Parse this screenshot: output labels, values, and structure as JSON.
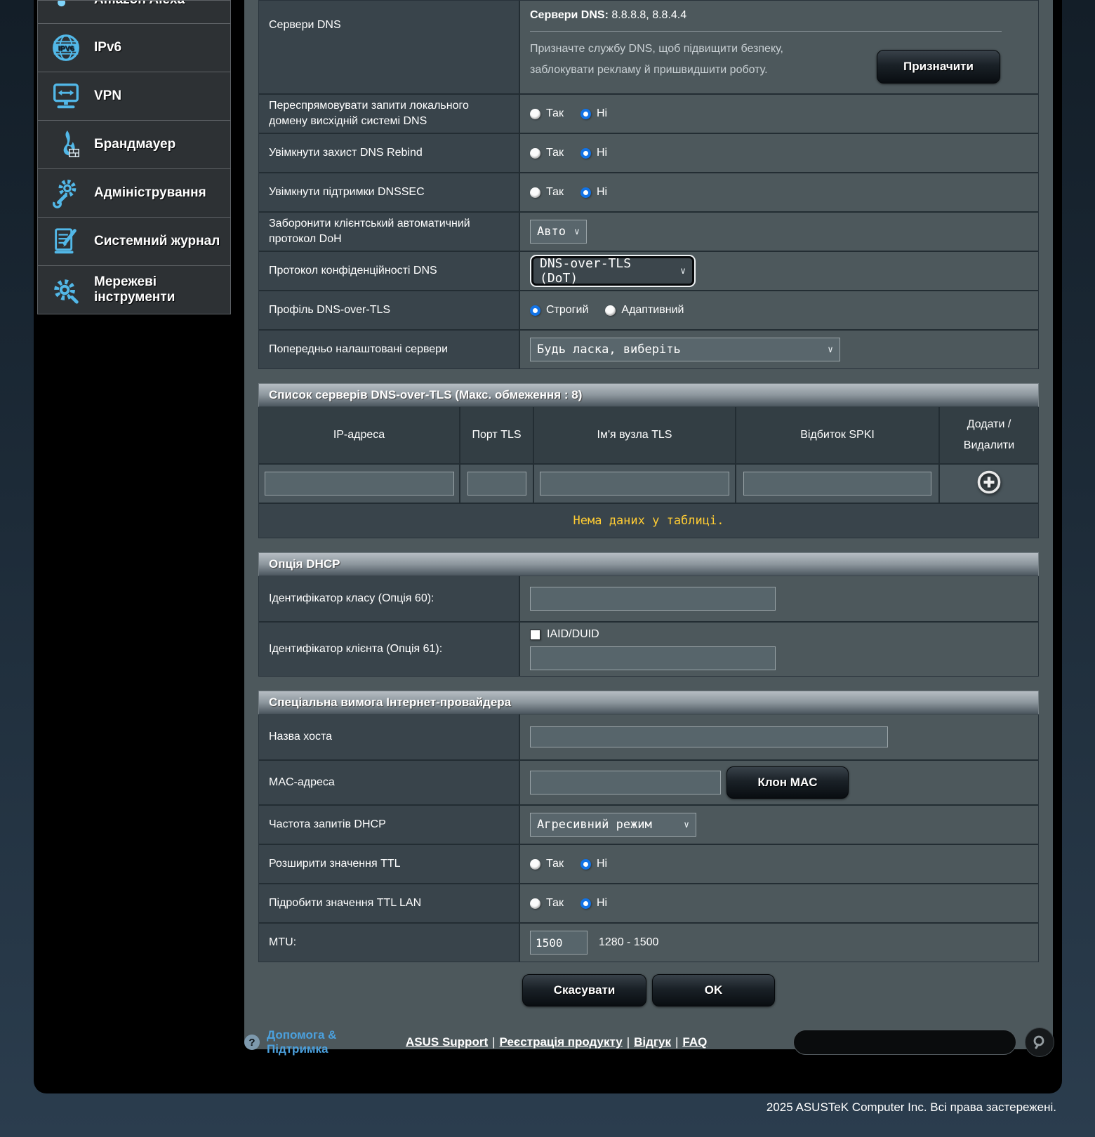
{
  "sidebar": {
    "items": [
      {
        "label": "Amazon Alexa",
        "icon": "alexa-icon"
      },
      {
        "label": "IPv6",
        "icon": "ipv6-icon"
      },
      {
        "label": "VPN",
        "icon": "vpn-icon"
      },
      {
        "label": "Брандмауер",
        "icon": "firewall-icon"
      },
      {
        "label": "Адміністрування",
        "icon": "administration-icon"
      },
      {
        "label": "Системний журнал",
        "icon": "system-log-icon"
      },
      {
        "label": "Мережеві інструменти",
        "icon": "network-tools-icon"
      }
    ]
  },
  "form": {
    "yes": "Так",
    "no": "Ні",
    "rows": {
      "dns_servers": {
        "label": "Сервери DNS",
        "value_label": "Сервери DNS:",
        "value": "8.8.8.8, 8.8.4.4",
        "desc1": "Призначте службу DNS, щоб підвищити безпеку,",
        "desc2": "заблокувати рекламу й пришвидшити роботу.",
        "assign_button": "Призначити"
      },
      "forward_local": {
        "label": "Переспрямовувати запити локального домену висхідній системі DNS",
        "selected": "Ні"
      },
      "dns_rebind": {
        "label": "Увімкнути захист DNS Rebind",
        "selected": "Ні"
      },
      "dnssec": {
        "label": "Увімкнути підтримки DNSSEC",
        "selected": "Ні"
      },
      "doh": {
        "label": "Заборонити клієнтський автоматичний протокол DoH",
        "value": "Авто"
      },
      "dns_privacy": {
        "label": "Протокол конфіденційності DNS",
        "value": "DNS-over-TLS (DoT)"
      },
      "dot_profile": {
        "label": "Профіль DNS-over-TLS",
        "options": [
          "Строгий",
          "Адаптивний"
        ],
        "selected": "Строгий"
      },
      "preset_servers": {
        "label": "Попередньо налаштовані сервери",
        "value": "Будь ласка, виберіть"
      }
    }
  },
  "dot_table": {
    "title": "Список серверів DNS-over-TLS (Макс. обмеження : 8)",
    "columns": [
      "IP-адреса",
      "Порт TLS",
      "Ім'я вузла TLS",
      "Відбиток SPKI"
    ],
    "add_col": {
      "line1": "Додати /",
      "line2": "Видалити"
    },
    "add_icon": "plus-circle-icon",
    "empty_text": "Нема даних у таблиці."
  },
  "dhcp": {
    "title": "Опція DHCP",
    "class_label": "Ідентифікатор класу (Опція 60):",
    "client_label": "Ідентифікатор клієнта (Опція 61):",
    "checkbox_label": "IAID/DUID",
    "checkbox_checked": false
  },
  "isp": {
    "title": "Спеціальна вимога Інтернет-провайдера",
    "hostname_label": "Назва хоста",
    "mac_label": "MAC-адреса",
    "mac_clone": "Клон MAC",
    "freq_label": "Частота запитів DHCP",
    "freq_value": "Агресивний режим",
    "ttl_label": "Розширити значення TTL",
    "ttl_selected": "Ні",
    "ttl_lan_label": "Підробити значення TTL LAN",
    "ttl_lan_selected": "Ні",
    "mtu_label": "MTU:",
    "mtu_value": "1500",
    "mtu_range": "1280 - 1500"
  },
  "actions": {
    "cancel": "Скасувати",
    "ok": "OK"
  },
  "footer": {
    "help_line1": "Допомога &",
    "help_line2": "Підтримка",
    "help_icon": "question-icon",
    "links": [
      "ASUS Support",
      "Реєстрація продукту",
      "Відгук",
      "FAQ"
    ],
    "separator": "|",
    "search_icon": "search-icon",
    "copyright": "2025 ASUSTeK Computer Inc. Всі права застережені."
  },
  "colors": {
    "accent_blue": "#52b8e8",
    "radio_selected": "#1273e6",
    "empty_text_yellow": "#ffcc33",
    "panel_bg": "#4d585c",
    "label_cell_bg": "#39444b",
    "frame_bg": "#000000",
    "link_blue": "#4ba0dd"
  }
}
